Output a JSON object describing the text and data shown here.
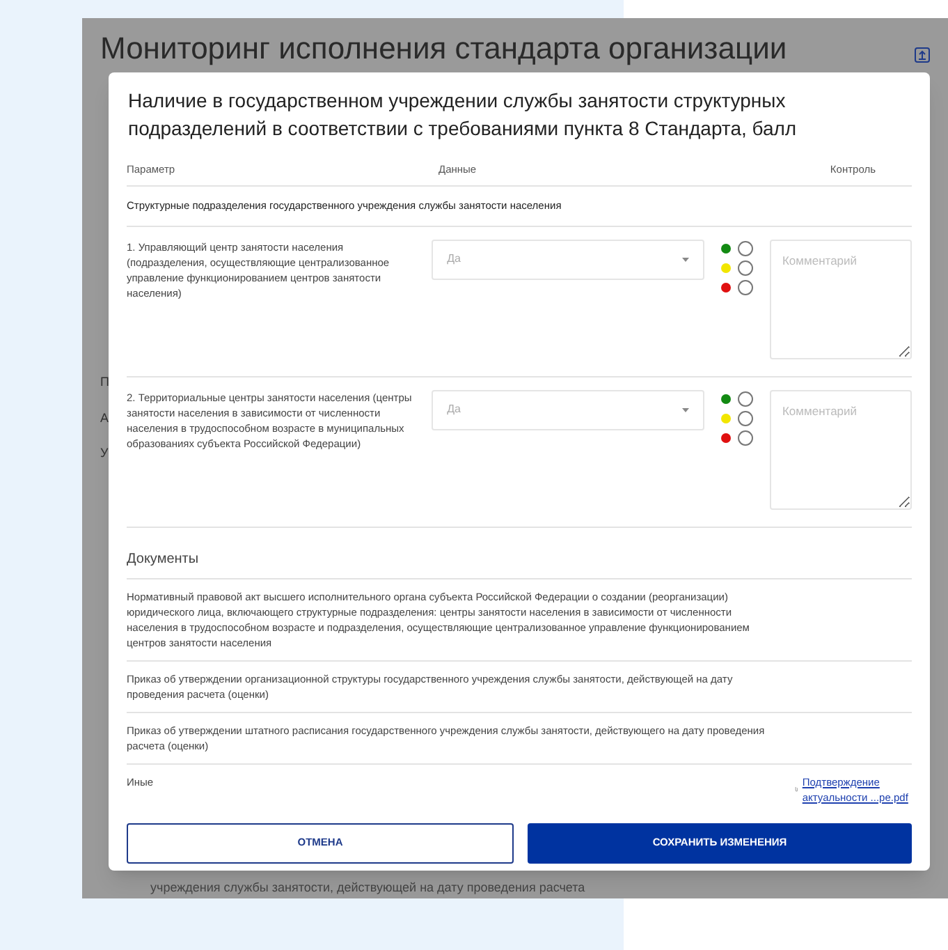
{
  "background_page": {
    "title": "Мониторинг исполнения стандарта организации",
    "row_fragments": [
      "П",
      "А",
      "У"
    ],
    "bottom_text": "учреждения службы занятости, действующей на дату проведения расчета"
  },
  "dialog": {
    "title": "Наличие в государственном учреждении службы занятости структурных подразделений в соответствии с требованиями пункта 8 Стандарта, балл",
    "columns": [
      "Параметр",
      "Данные",
      "Контроль"
    ],
    "section": "Структурные подразделения государственного учреждения службы занятости населения",
    "rows": [
      {
        "parameter": "1. Управляющий центр занятости населения (подразделения, осуществляющие централизованное управление функционированием центров занятости населения)",
        "value": "Да",
        "comment_placeholder": "Комментарий",
        "controls": [
          {
            "color": "#138a13",
            "selected": false
          },
          {
            "color": "#f2e600",
            "selected": false
          },
          {
            "color": "#e01010",
            "selected": false
          }
        ]
      },
      {
        "parameter": "2. Территориальные центры занятости населения (центры занятости населения в зависимости от численности населения в трудоспособном возрасте в муниципальных образованиях субъекта Российской Федерации)",
        "value": "Да",
        "comment_placeholder": "Комментарий",
        "controls": [
          {
            "color": "#138a13",
            "selected": false
          },
          {
            "color": "#f2e600",
            "selected": false
          },
          {
            "color": "#e01010",
            "selected": false
          }
        ]
      }
    ],
    "documents_title": "Документы",
    "documents": [
      {
        "text": "Нормативный правовой акт высшего исполнительного органа субъекта Российской Федерации о создании (реорганизации) юридического лица, включающего структурные подразделения: центры занятости населения в зависимости от численности населения в трудоспособном возрасте и подразделения, осуществляющие централизованное управление функционированием центров занятости населения"
      },
      {
        "text": "Приказ об утверждении организационной структуры государственного учреждения службы занятости, действующей на дату проведения расчета (оценки)"
      },
      {
        "text": "Приказ об утверждении штатного расписания государственного учреждения службы занятости, действующего на дату проведения расчета (оценки)"
      },
      {
        "text": "Иные",
        "file": "Подтверждение актуальности ...ре.pdf"
      }
    ],
    "buttons": [
      {
        "kind": "secondary",
        "label": "ОТМЕНА"
      },
      {
        "kind": "primary",
        "label": "СОХРАНИТЬ ИЗМЕНЕНИЯ"
      }
    ]
  }
}
